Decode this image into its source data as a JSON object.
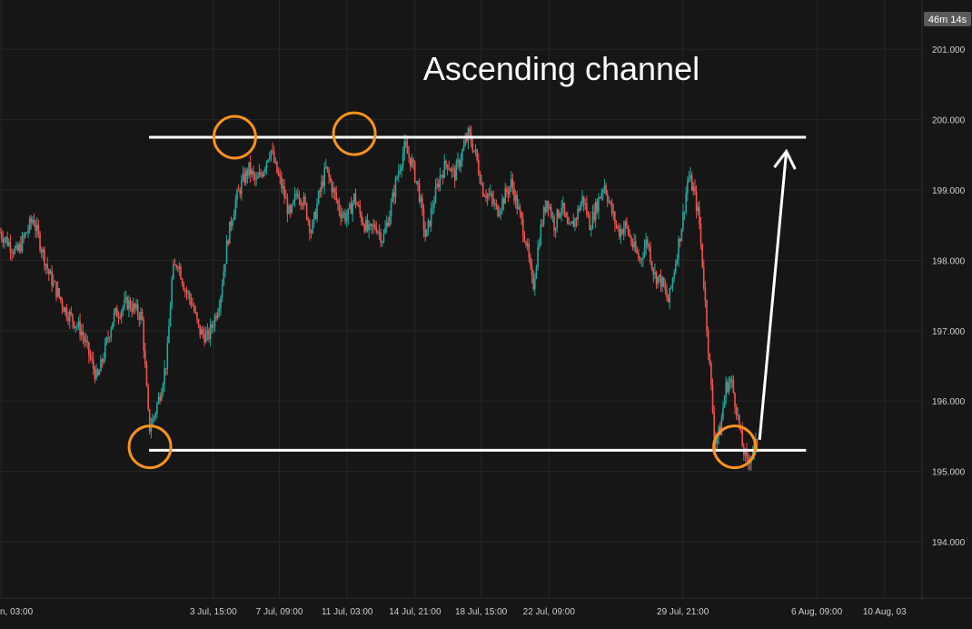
{
  "chart_data": {
    "type": "candlestick",
    "title": "Ascending channel",
    "countdown": "46m 14s",
    "colors": {
      "background": "#161616",
      "grid": "#262626",
      "up": "#26a69a",
      "down": "#ef5350",
      "annotation_line": "#ffffff",
      "circle": "#f7931a",
      "text": "#cfcfcf"
    },
    "ylim": [
      193.2,
      201.7
    ],
    "y_ticks": [
      "201.000",
      "200.000",
      "199.000",
      "198.000",
      "197.000",
      "196.000",
      "195.000",
      "194.000"
    ],
    "x_ticks": [
      "n, 03:00",
      "3 Jul, 15:00",
      "7 Jul, 09:00",
      "11 Jul, 03:00",
      "14 Jul, 21:00",
      "18 Jul, 15:00",
      "22 Jul, 09:00",
      "29 Jul, 21:00",
      "6 Aug, 09:00",
      "10 Aug, 03"
    ],
    "x_tick_positions": [
      -8.3,
      3.6,
      7.3,
      11.1,
      14.9,
      18.6,
      22.4,
      29.9,
      37.4,
      41.2
    ],
    "xlim": [
      -8.35,
      43.3
    ],
    "price_path": [
      [
        -8.35,
        198.4
      ],
      [
        -7.4,
        198.1
      ],
      [
        -6.5,
        198.6
      ],
      [
        -5.6,
        197.8
      ],
      [
        -4.7,
        197.3
      ],
      [
        -3.8,
        197.0
      ],
      [
        -2.9,
        196.3
      ],
      [
        -2.0,
        197.2
      ],
      [
        -1.2,
        197.4
      ],
      [
        -0.4,
        197.2
      ],
      [
        0.0,
        195.6
      ],
      [
        0.3,
        195.8
      ],
      [
        0.6,
        196.1
      ],
      [
        1.0,
        196.6
      ],
      [
        1.3,
        197.8
      ],
      [
        1.6,
        198.0
      ],
      [
        2.0,
        197.6
      ],
      [
        2.4,
        197.4
      ],
      [
        2.8,
        197.0
      ],
      [
        3.3,
        196.9
      ],
      [
        3.7,
        197.2
      ],
      [
        4.0,
        197.5
      ],
      [
        4.4,
        198.3
      ],
      [
        4.8,
        198.8
      ],
      [
        5.2,
        199.1
      ],
      [
        5.6,
        199.3
      ],
      [
        6.0,
        199.1
      ],
      [
        6.4,
        199.3
      ],
      [
        6.8,
        199.6
      ],
      [
        7.1,
        199.3
      ],
      [
        7.5,
        199.0
      ],
      [
        7.9,
        198.6
      ],
      [
        8.3,
        199.0
      ],
      [
        8.7,
        198.8
      ],
      [
        9.1,
        198.4
      ],
      [
        9.5,
        198.9
      ],
      [
        9.9,
        199.3
      ],
      [
        10.3,
        199.0
      ],
      [
        10.7,
        198.7
      ],
      [
        11.1,
        198.6
      ],
      [
        11.5,
        198.9
      ],
      [
        11.9,
        198.6
      ],
      [
        12.3,
        198.4
      ],
      [
        12.7,
        198.5
      ],
      [
        13.1,
        198.3
      ],
      [
        13.5,
        198.7
      ],
      [
        13.9,
        199.2
      ],
      [
        14.3,
        199.6
      ],
      [
        14.7,
        199.4
      ],
      [
        15.1,
        199.0
      ],
      [
        15.5,
        198.3
      ],
      [
        15.9,
        198.8
      ],
      [
        16.3,
        199.2
      ],
      [
        16.7,
        199.4
      ],
      [
        17.1,
        199.2
      ],
      [
        17.5,
        199.5
      ],
      [
        17.9,
        199.8
      ],
      [
        18.3,
        199.5
      ],
      [
        18.7,
        199.0
      ],
      [
        19.1,
        198.9
      ],
      [
        19.5,
        198.7
      ],
      [
        19.9,
        198.9
      ],
      [
        20.3,
        199.1
      ],
      [
        20.7,
        198.7
      ],
      [
        21.1,
        198.3
      ],
      [
        21.5,
        197.6
      ],
      [
        21.9,
        198.4
      ],
      [
        22.3,
        198.9
      ],
      [
        22.7,
        198.5
      ],
      [
        23.1,
        198.8
      ],
      [
        23.5,
        198.4
      ],
      [
        23.9,
        198.6
      ],
      [
        24.3,
        198.9
      ],
      [
        24.7,
        198.5
      ],
      [
        25.1,
        198.8
      ],
      [
        25.5,
        199.1
      ],
      [
        25.9,
        198.7
      ],
      [
        26.3,
        198.4
      ],
      [
        26.7,
        198.5
      ],
      [
        27.1,
        198.2
      ],
      [
        27.5,
        198.0
      ],
      [
        27.9,
        198.3
      ],
      [
        28.3,
        197.8
      ],
      [
        28.7,
        197.7
      ],
      [
        29.1,
        197.4
      ],
      [
        29.5,
        198.0
      ],
      [
        29.9,
        198.6
      ],
      [
        30.2,
        199.2
      ],
      [
        30.5,
        199.0
      ],
      [
        30.8,
        198.6
      ],
      [
        31.1,
        197.6
      ],
      [
        31.4,
        196.5
      ],
      [
        31.7,
        195.4
      ],
      [
        32.0,
        195.6
      ],
      [
        32.3,
        196.2
      ],
      [
        32.6,
        196.3
      ],
      [
        32.9,
        195.9
      ],
      [
        33.2,
        195.4
      ],
      [
        33.5,
        195.1
      ],
      [
        33.8,
        195.3
      ],
      [
        34.1,
        195.4
      ]
    ],
    "annotations": {
      "upper_line": {
        "x": [
          0.0,
          36.8
        ],
        "y": 199.75
      },
      "lower_line": {
        "x": [
          0.0,
          36.8
        ],
        "y": 195.3
      },
      "arrow": {
        "from": [
          34.2,
          195.45
        ],
        "to": [
          35.7,
          199.55
        ]
      },
      "circles": [
        [
          0.05,
          195.35
        ],
        [
          4.8,
          199.75
        ],
        [
          11.5,
          199.8
        ],
        [
          32.8,
          195.35
        ]
      ]
    }
  }
}
